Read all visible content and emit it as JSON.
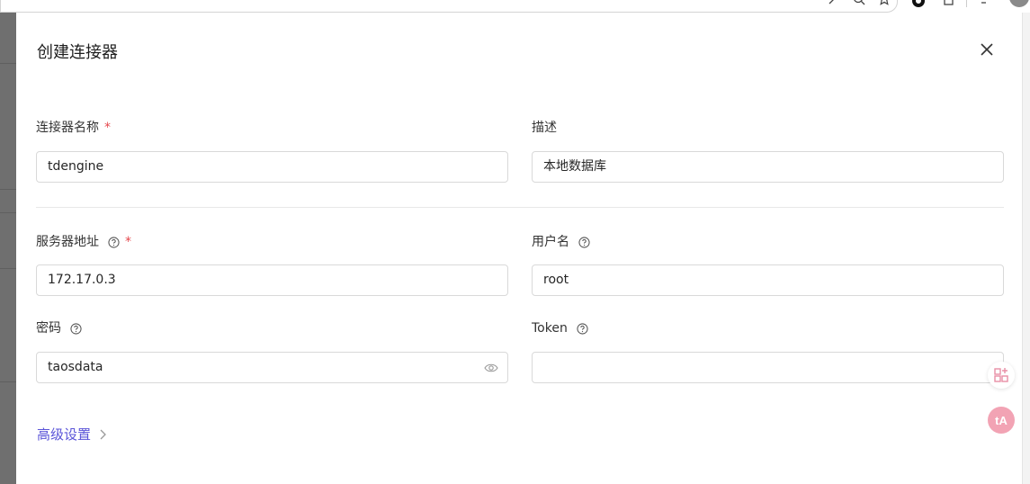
{
  "drawer": {
    "title": "创建连接器"
  },
  "form": {
    "name": {
      "label": "连接器名称",
      "required_mark": "*",
      "value": "tdengine"
    },
    "description": {
      "label": "描述",
      "value": "本地数据库"
    },
    "server": {
      "label": "服务器地址",
      "required_mark": "*",
      "value": "172.17.0.3"
    },
    "username": {
      "label": "用户名",
      "value": "root"
    },
    "password": {
      "label": "密码",
      "value": "taosdata"
    },
    "token": {
      "label": "Token",
      "value": ""
    }
  },
  "advanced": {
    "label": "高级设置"
  },
  "colors": {
    "accent": "#5a54d8",
    "required": "#e5484d",
    "border": "#d9d9d9",
    "translate_button": "#f2a3b4"
  },
  "icons": {
    "close": "close-icon",
    "help": "question-circle-icon",
    "eye": "eye-icon",
    "chevron": "chevron-right-icon"
  }
}
